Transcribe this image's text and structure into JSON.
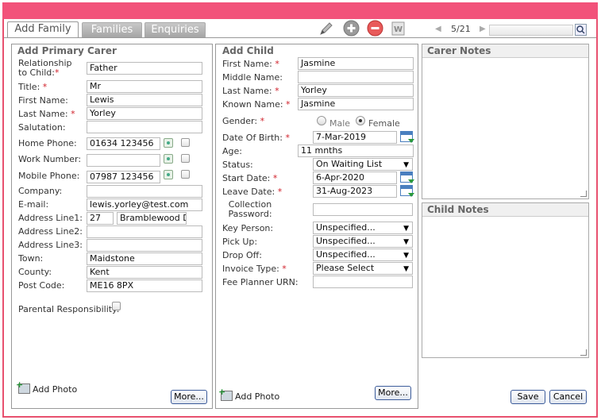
{
  "colors": {
    "accent": "#f2527a",
    "border": "#e8516f",
    "required": "#d0202a"
  },
  "tabs": [
    {
      "label": "Add Family"
    },
    {
      "label": "Families"
    },
    {
      "label": "Enquiries"
    }
  ],
  "toolbar": {
    "icons": [
      "pencil-icon",
      "add-icon",
      "remove-icon",
      "word-doc-icon"
    ]
  },
  "pager": {
    "count": "5/21",
    "prev_icon": "◀",
    "next_icon": "▶"
  },
  "carer": {
    "title": "Add Primary Carer",
    "fields": {
      "relationship": {
        "label": "Relationship to Child:",
        "req": "*",
        "value": "Father"
      },
      "title": {
        "label": "Title:",
        "req": "*",
        "value": "Mr"
      },
      "first_name": {
        "label": "First Name:",
        "value": "Lewis"
      },
      "last_name": {
        "label": "Last Name:",
        "req": "*",
        "value": "Yorley"
      },
      "salutation": {
        "label": "Salutation:",
        "value": ""
      },
      "home_phone": {
        "label": "Home Phone:",
        "value": "01634 123456"
      },
      "work_number": {
        "label": "Work Number:",
        "value": ""
      },
      "mobile_phone": {
        "label": "Mobile Phone:",
        "value": "07987 123456"
      },
      "company": {
        "label": "Company:",
        "value": ""
      },
      "email": {
        "label": "E-mail:",
        "value": "lewis.yorley@test.com"
      },
      "address1": {
        "label": "Address Line1:",
        "number": "27",
        "street": "Bramblewood Dri"
      },
      "address2": {
        "label": "Address Line2:",
        "value": ""
      },
      "address3": {
        "label": "Address Line3:",
        "value": ""
      },
      "town": {
        "label": "Town:",
        "value": "Maidstone"
      },
      "county": {
        "label": "County:",
        "value": "Kent"
      },
      "postcode": {
        "label": "Post Code:",
        "value": "ME16 8PX"
      },
      "parental": {
        "label": "Parental Responsibility:"
      }
    },
    "add_photo": "Add Photo",
    "more": "More..."
  },
  "child": {
    "title": "Add Child",
    "fields": {
      "first_name": {
        "label": "First Name:",
        "req": "*",
        "value": "Jasmine"
      },
      "middle_name": {
        "label": "Middle Name:",
        "value": ""
      },
      "last_name": {
        "label": "Last Name:",
        "req": "*",
        "value": "Yorley"
      },
      "known_name": {
        "label": "Known Name:",
        "req": "*",
        "value": "Jasmine"
      },
      "gender": {
        "label": "Gender:",
        "req": "*",
        "male": "Male",
        "female": "Female"
      },
      "dob": {
        "label": "Date Of Birth:",
        "req": "*",
        "value": "7-Mar-2019"
      },
      "age": {
        "label": "Age:",
        "value": "11 mnths"
      },
      "status": {
        "label": "Status:",
        "value": "On Waiting List"
      },
      "start_date": {
        "label": "Start Date:",
        "req": "*",
        "value": "6-Apr-2020"
      },
      "leave_date": {
        "label": "Leave Date:",
        "req": "*",
        "value": "31-Aug-2023"
      },
      "collection_password": {
        "label": "Collection Password:",
        "value": ""
      },
      "key_person": {
        "label": "Key Person:",
        "value": "Unspecified..."
      },
      "pick_up": {
        "label": "Pick Up:",
        "value": "Unspecified..."
      },
      "drop_off": {
        "label": "Drop Off:",
        "value": "Unspecified..."
      },
      "invoice_type": {
        "label": "Invoice Type:",
        "req": "*",
        "value": "Please Select"
      },
      "fee_planner": {
        "label": "Fee Planner URN:",
        "value": ""
      }
    },
    "add_photo": "Add Photo",
    "more": "More..."
  },
  "notes": {
    "carer_title": "Carer Notes",
    "child_title": "Child Notes"
  },
  "actions": {
    "save": "Save",
    "cancel": "Cancel"
  }
}
